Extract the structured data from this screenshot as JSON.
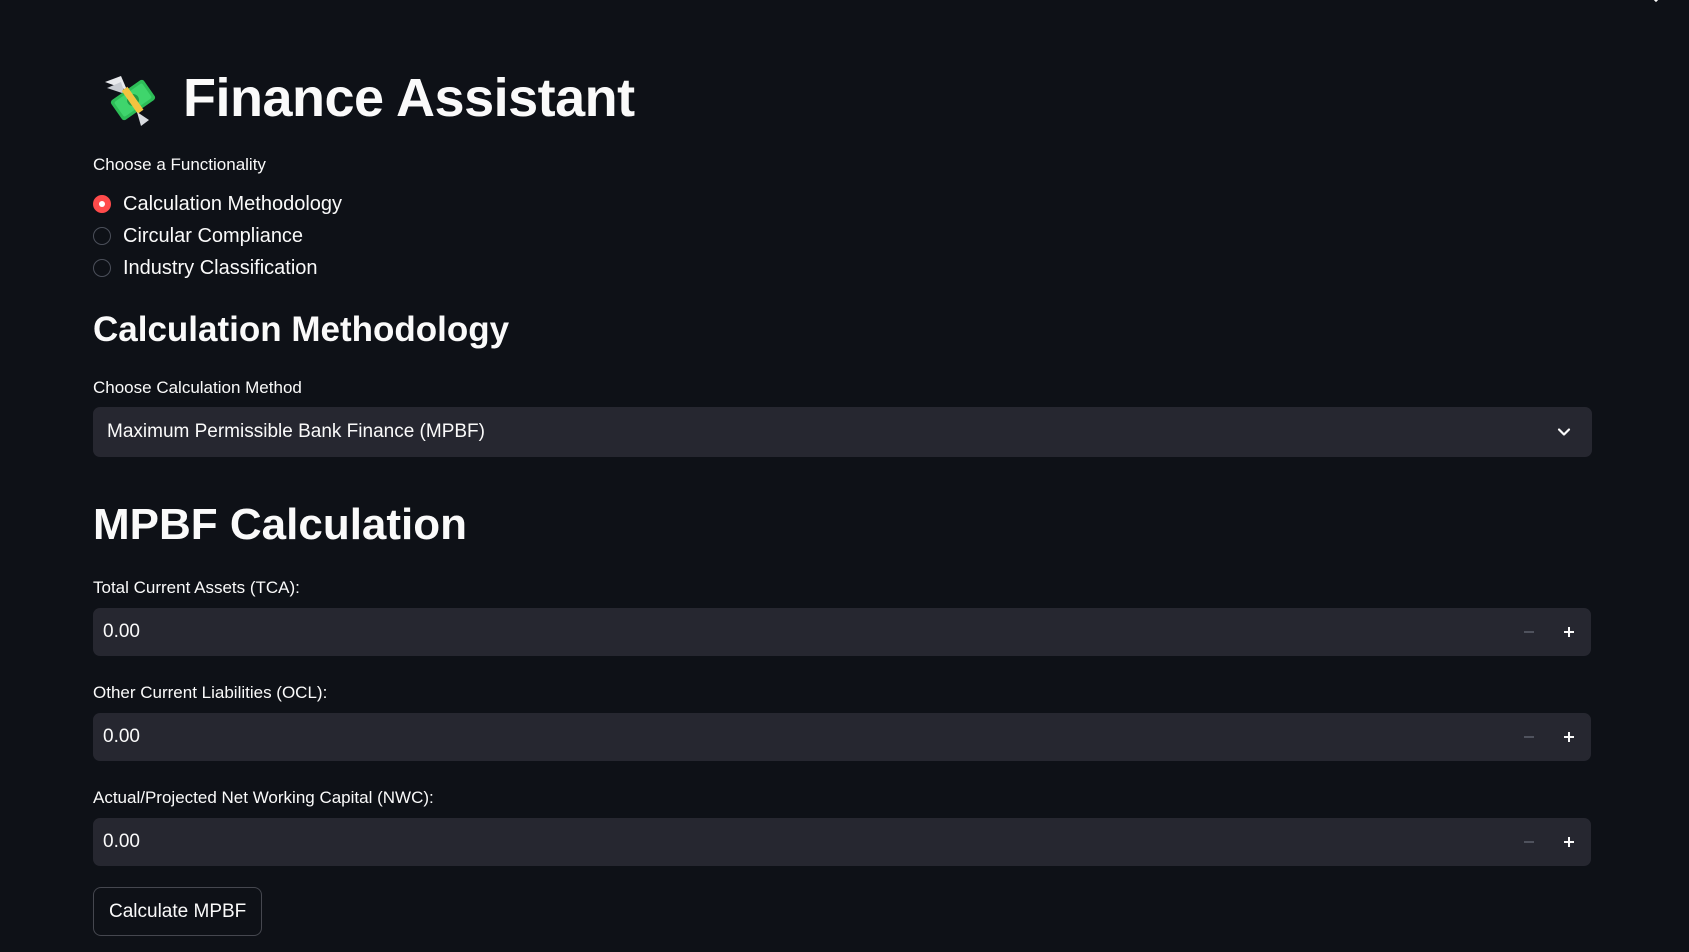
{
  "app": {
    "title": "Finance Assistant",
    "title_icon": "money-with-wings-icon"
  },
  "functionality": {
    "label": "Choose a Functionality",
    "options": [
      {
        "label": "Calculation Methodology",
        "selected": true
      },
      {
        "label": "Circular Compliance",
        "selected": false
      },
      {
        "label": "Industry Classification",
        "selected": false
      }
    ]
  },
  "section": {
    "heading": "Calculation Methodology",
    "method_label": "Choose Calculation Method",
    "method_value": "Maximum Permissible Bank Finance (MPBF)"
  },
  "mpbf": {
    "heading": "MPBF Calculation",
    "fields": [
      {
        "label": "Total Current Assets (TCA):",
        "value": "0.00"
      },
      {
        "label": "Other Current Liabilities (OCL):",
        "value": "0.00"
      },
      {
        "label": "Actual/Projected Net Working Capital (NWC):",
        "value": "0.00"
      }
    ],
    "button_label": "Calculate MPBF"
  },
  "colors": {
    "background": "#0e1117",
    "accent": "#ff4b4b",
    "input_bg": "#262730",
    "text": "#fafafa"
  }
}
